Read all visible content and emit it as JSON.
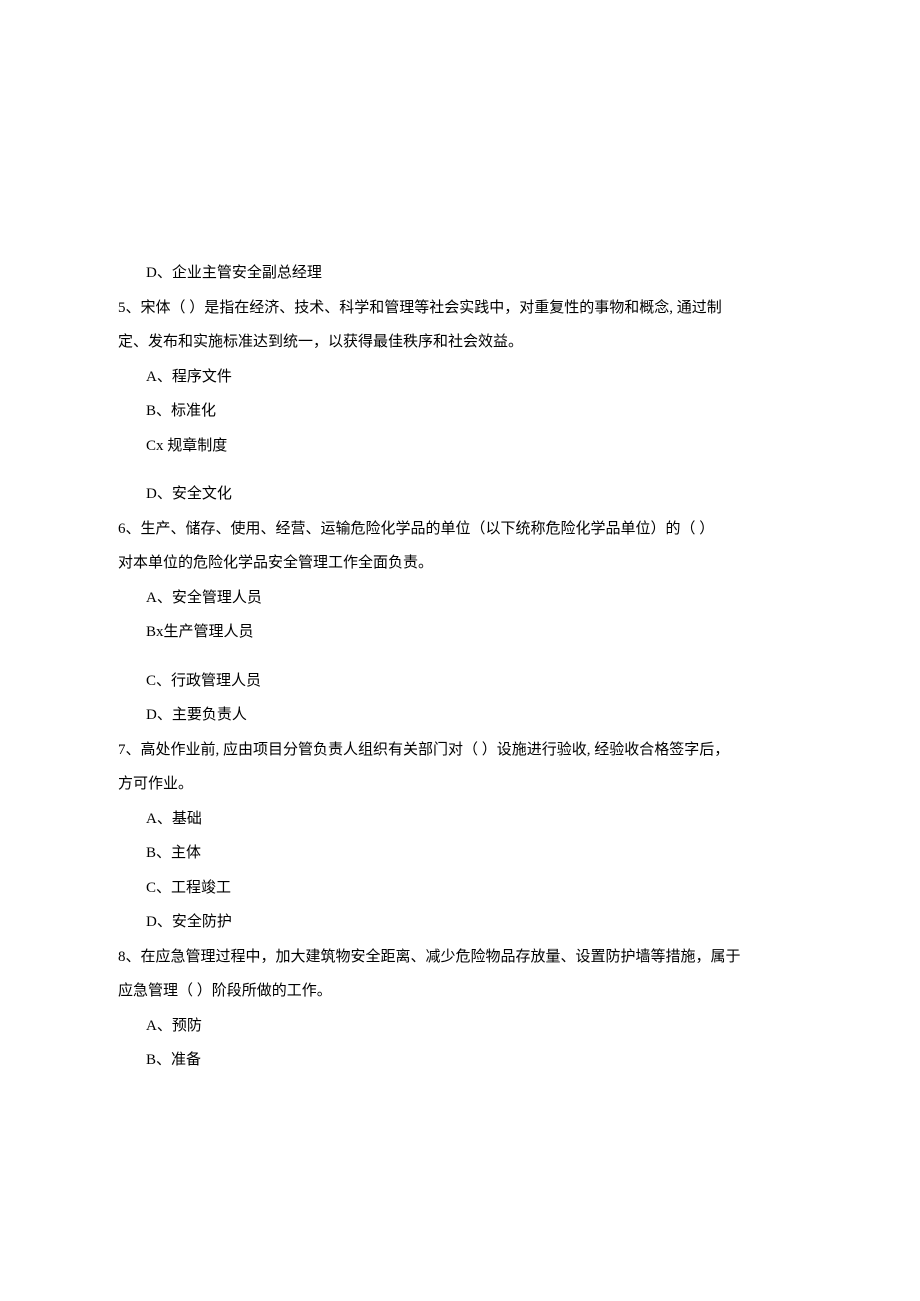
{
  "lines": {
    "q4_d": "D、企业主管安全副总经理",
    "q5_stem1": "5、宋体（    ）是指在经济、技术、科学和管理等社会实践中，对重复性的事物和概念, 通过制",
    "q5_stem2": "定、发布和实施标准达到统一，以获得最佳秩序和社会效益。",
    "q5_a": "A、程序文件",
    "q5_b": "B、标准化",
    "q5_c": "Cx 规章制度",
    "q5_d": "D、安全文化",
    "q6_stem1": "6、生产、储存、使用、经营、运输危险化学品的单位（以下统称危险化学品单位）的（    ）",
    "q6_stem2": "对本单位的危险化学品安全管理工作全面负责。",
    "q6_a": "A、安全管理人员",
    "q6_b": "Bx生产管理人员",
    "q6_c": "C、行政管理人员",
    "q6_d": "D、主要负责人",
    "q7_stem1": "7、高处作业前, 应由项目分管负责人组织有关部门对（    ）设施进行验收, 经验收合格签字后，",
    "q7_stem2": "方可作业。",
    "q7_a": "A、基础",
    "q7_b": "B、主体",
    "q7_c": "C、工程竣工",
    "q7_d": "D、安全防护",
    "q8_stem1": "8、在应急管理过程中，加大建筑物安全距离、减少危险物品存放量、设置防护墙等措施，属于",
    "q8_stem2": "应急管理（    ）阶段所做的工作。",
    "q8_a": "A、预防",
    "q8_b": "B、准备"
  }
}
